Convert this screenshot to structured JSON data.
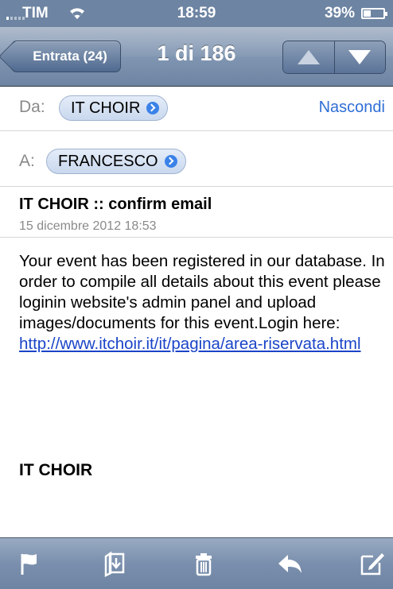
{
  "status_bar": {
    "carrier": "TIM",
    "time": "18:59",
    "battery_percent": "39%",
    "battery_level": 0.39
  },
  "nav": {
    "back_label": "Entrata (24)",
    "title": "1 di 186",
    "prev_icon": "up-arrow-icon",
    "next_icon": "down-arrow-icon"
  },
  "header": {
    "from_label": "Da:",
    "from_value": "IT CHOIR",
    "hide_label": "Nascondi",
    "to_label": "A:",
    "to_value": "FRANCESCO"
  },
  "message": {
    "subject": "IT CHOIR :: confirm email",
    "date": "15 dicembre 2012 18:53",
    "body": "Your event has been registered in our database. In order to compile all details about this event please loginin website's admin panel and upload images/documents for this event.Login here:",
    "link": "http://www.itchoir.it/it/pagina/area-riservata.html",
    "signature": "IT CHOIR"
  },
  "toolbar": {
    "icons": [
      "flag-icon",
      "move-folder-icon",
      "trash-icon",
      "reply-icon",
      "compose-icon"
    ]
  },
  "colors": {
    "bar_blue": "#6d84a2",
    "link_blue": "#1a44c8",
    "accent_blue": "#2f6fd6"
  }
}
